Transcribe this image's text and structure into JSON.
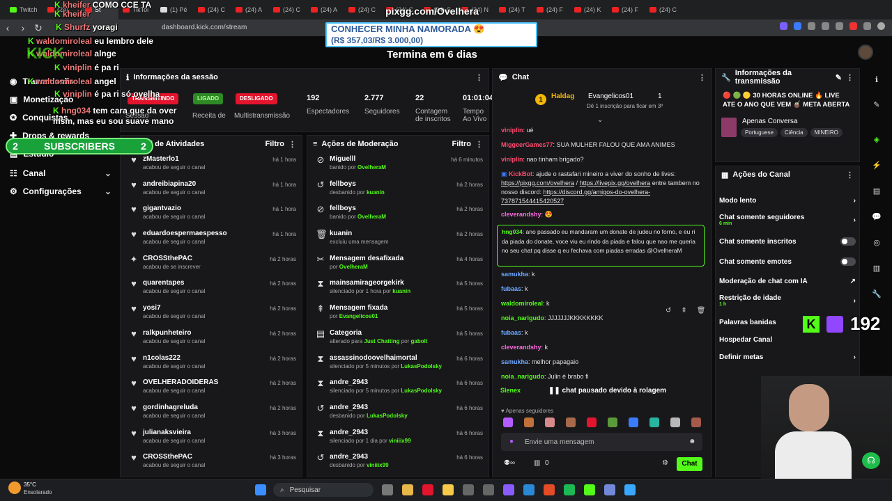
{
  "browser": {
    "tabs": [
      "Twitch",
      "(24)",
      "St",
      "TikToi",
      "(1) Pé",
      "(24) C",
      "(24) A",
      "(24) C",
      "(24) A",
      "(24) C",
      "(24) C",
      "(24) C",
      "(24) N",
      "(24) T",
      "(24) F",
      "(24) K",
      "(24) F",
      "(24) C"
    ],
    "url": "dashboard.kick.com/stream"
  },
  "overlay": {
    "pix": "pixgg.com/Ovelhera",
    "banner_line1": "CONHECER MINHA NAMORADA 😍",
    "banner_line2": "(R$ 357,03/R$ 3.000,00)",
    "termina": "Termina em 6 dias",
    "subs_left": "2",
    "subs_label": "SUBSCRIBERS",
    "subs_right": "2",
    "kick_count": "192",
    "stream_chat": [
      {
        "user": "kheifer",
        "msg": "COMO CCE TA"
      },
      {
        "user": "kheifer",
        "msg": ""
      },
      {
        "user": "Shurfz",
        "msg": "yoragi"
      },
      {
        "user": "waldomiroleal",
        "msg": "eu lembro dele"
      },
      {
        "user": "waldomiroleal",
        "msg": "alnge"
      },
      {
        "user": "viniplin",
        "msg": "é pa ri"
      },
      {
        "user": "waldomiroleal",
        "msg": "angel"
      },
      {
        "user": "viniplin",
        "msg": "é pa ri só ovelha"
      },
      {
        "user": "hng034",
        "msg": "tem cara que da over msm, mas eu sou suave mano"
      }
    ]
  },
  "nav": {
    "items": [
      "Transmissão",
      "Monetização",
      "Conquistas",
      "Drops & rewards",
      "Estúdio",
      "Canal",
      "Configurações"
    ]
  },
  "session": {
    "title": "Informações da sessão",
    "badges": [
      "TRANSMITINDO",
      "LIGADO",
      "DESLIGADO"
    ],
    "labels": [
      "Sessão",
      "Receita de",
      "Multistransmissão"
    ],
    "stats": [
      {
        "value": "192",
        "label": "Espectadores"
      },
      {
        "value": "2.777",
        "label": "Seguidores"
      },
      {
        "value": "22",
        "label": "Contagem de inscritos"
      },
      {
        "value": "01:01:04",
        "label": "Tempo Ao Vivo"
      }
    ]
  },
  "activity": {
    "title": "Feed de Atividades",
    "filter": "Filtro",
    "rows": [
      {
        "name": "zMasterlo1",
        "desc": "acabou de seguir o canal",
        "time": "há 1 hora",
        "icon": "heart"
      },
      {
        "name": "andreibiapina20",
        "desc": "acabou de seguir o canal",
        "time": "há 1 hora",
        "icon": "heart"
      },
      {
        "name": "gigantvazio",
        "desc": "acabou de seguir o canal",
        "time": "há 1 hora",
        "icon": "heart"
      },
      {
        "name": "eduardoespermaespesso",
        "desc": "acabou de seguir o canal",
        "time": "há 1 hora",
        "icon": "heart"
      },
      {
        "name": "CROSSthePAC",
        "desc": "acabou de se inscrever",
        "time": "há 2 horas",
        "icon": "star"
      },
      {
        "name": "quarentapes",
        "desc": "acabou de seguir o canal",
        "time": "há 2 horas",
        "icon": "heart"
      },
      {
        "name": "yosi7",
        "desc": "acabou de seguir o canal",
        "time": "há 2 horas",
        "icon": "heart"
      },
      {
        "name": "ralkpunheteiro",
        "desc": "acabou de seguir o canal",
        "time": "há 2 horas",
        "icon": "heart"
      },
      {
        "name": "n1colas222",
        "desc": "acabou de seguir o canal",
        "time": "há 2 horas",
        "icon": "heart"
      },
      {
        "name": "OVELHERADOIDERAS",
        "desc": "acabou de seguir o canal",
        "time": "há 2 horas",
        "icon": "heart"
      },
      {
        "name": "gordinhagreluda",
        "desc": "acabou de seguir o canal",
        "time": "há 2 horas",
        "icon": "heart"
      },
      {
        "name": "julianaksvieira",
        "desc": "acabou de seguir o canal",
        "time": "há 3 horas",
        "icon": "heart"
      },
      {
        "name": "CROSSthePAC",
        "desc": "acabou de seguir o canal",
        "time": "há 3 horas",
        "icon": "heart"
      }
    ]
  },
  "moderation": {
    "title": "Ações de Moderação",
    "filter": "Filtro",
    "rows": [
      {
        "name": "Miguelll",
        "desc": "banido por",
        "by": "OvelheraM",
        "time": "há 6 minutos",
        "icon": "ban"
      },
      {
        "name": "fellboys",
        "desc": "desbanido por",
        "by": "kuanin",
        "time": "há 2 horas",
        "icon": "undo"
      },
      {
        "name": "fellboys",
        "desc": "banido por",
        "by": "OvelheraM",
        "time": "há 2 horas",
        "icon": "ban"
      },
      {
        "name": "kuanin",
        "desc": "excluiu uma mensagem",
        "by": "",
        "time": "há 2 horas",
        "icon": "trash"
      },
      {
        "name": "Mensagem desafixada",
        "desc": "por",
        "by": "OvelheraM",
        "time": "há 4 horas",
        "icon": "unpin"
      },
      {
        "name": "mainsamirageorgekirk",
        "desc": "silenciado por 1 hora por",
        "by": "kuanin",
        "time": "há 5 horas",
        "icon": "hourglass"
      },
      {
        "name": "Mensagem fixada",
        "desc": "por",
        "by": "Evangelicos01",
        "time": "há 5 horas",
        "icon": "pin"
      },
      {
        "name": "Categoria",
        "desc": "alterado para",
        "by": "Just Chatting",
        "by2": "gabolt",
        "time": "há 5 horas",
        "icon": "doc"
      },
      {
        "name": "assassinodoovelhaimortal",
        "desc": "silenciado por 5 minutos por",
        "by": "LukasPodolsky",
        "time": "há 6 horas",
        "icon": "hourglass"
      },
      {
        "name": "andre_2943",
        "desc": "silenciado por 5 minutos por",
        "by": "LukasPodolsky",
        "time": "há 6 horas",
        "icon": "hourglass"
      },
      {
        "name": "andre_2943",
        "desc": "desbanido por",
        "by": "LukasPodolsky",
        "time": "há 6 horas",
        "icon": "undo"
      },
      {
        "name": "andre_2943",
        "desc": "silenciado por 1 dia por",
        "by": "viniiix99",
        "time": "há 6 horas",
        "icon": "hourglass"
      },
      {
        "name": "andre_2943",
        "desc": "desbanido por",
        "by": "viniiix99",
        "time": "há 6 horas",
        "icon": "undo"
      }
    ]
  },
  "chat": {
    "title": "Chat",
    "pinned_user": "Haldag",
    "pinned_name": "Evangelicos01",
    "pinned_count": "1",
    "pinned_sub": "Dê 1 inscrição para ficar em 3º",
    "messages": [
      {
        "user": "viniplin",
        "color": "#ff4b6e",
        "text": "ué"
      },
      {
        "user": "MiggeerGames77",
        "color": "#ff4b6e",
        "text": "SUA MULHER FALOU QUE AMA ANIMES"
      },
      {
        "user": "viniplin",
        "color": "#ff4b6e",
        "text": "nao tinham brigado?"
      }
    ],
    "kickbot_user": "KickBot",
    "kickbot_text1": "ajude o rastafari mineiro a viver do sonho de lives:",
    "kickbot_link1": "https://pixgg.com/ovelhera",
    "kickbot_sep": "/",
    "kickbot_link2": "https://livepix.gg/ovelhera",
    "kickbot_text2": "entre tambem no nosso discord:",
    "kickbot_link3": "https://discord.gg/amigos-do-ovelhera-737871544415420527",
    "m_clever": {
      "user": "cleverandshy",
      "text": "😍"
    },
    "hl_user": "hng034",
    "hl_text": "ano passado eu mandaram um donate de judeu no forno, e eu ri da piada do donate, voce viu eu rindo da piada e falou que nao me queria no seu chat pq disse q eu fechava com piadas erradas @OvelheraM",
    "messages2": [
      {
        "user": "samukha",
        "color": "#6ea8ff",
        "text": "k"
      },
      {
        "user": "fubaas",
        "color": "#6ea8ff",
        "text": "k"
      },
      {
        "user": "waldomiroleal",
        "color": "#53fc18",
        "text": "k"
      },
      {
        "user": "noia_narigudo",
        "color": "#53fc18",
        "text": "JJJJJJJKKKKKKKK"
      },
      {
        "user": "fubaas",
        "color": "#6ea8ff",
        "text": "k"
      },
      {
        "user": "cleverandshy",
        "color": "#ff6be0",
        "text": "k"
      },
      {
        "user": "samukha",
        "color": "#6ea8ff",
        "text": "melhor papagaio"
      },
      {
        "user": "noia_narigudo",
        "color": "#53fc18",
        "text": "Julin é brabo fi"
      }
    ],
    "paused": "chat pausado devido à rolagem",
    "slenex": "Slenex",
    "followers_only": "Apenas seguidores",
    "placeholder": "Envie uma mensagem",
    "count": "0",
    "send": "Chat"
  },
  "transmission": {
    "title": "Informações da transmissão",
    "stream_title": "🔴 🟢 🟡 30 HORAS ONLINE 🔥 LIVE ATE O ANO QUE VEM 🧉 META ABERTA PR...",
    "category": "Apenas Conversa",
    "tags": [
      "Portuguese",
      "Ciência",
      "MINEIRO"
    ]
  },
  "channel_actions": {
    "title": "Ações do Canal",
    "rows": [
      {
        "label": "Modo lento",
        "sub": "",
        "type": "chev"
      },
      {
        "label": "Chat somente seguidores",
        "sub": "6 min",
        "type": "chev"
      },
      {
        "label": "Chat somente inscritos",
        "sub": "",
        "type": "toggle"
      },
      {
        "label": "Chat somente emotes",
        "sub": "",
        "type": "toggle"
      },
      {
        "label": "Moderação de chat com IA",
        "sub": "",
        "type": "ext"
      },
      {
        "label": "Restrição de idade",
        "sub": "1 h",
        "type": "chev"
      },
      {
        "label": "Palavras banidas",
        "sub": "",
        "type": "none"
      },
      {
        "label": "Hospedar Canal",
        "sub": "",
        "type": "none"
      },
      {
        "label": "Definir metas",
        "sub": "",
        "type": "chev"
      }
    ]
  },
  "taskbar": {
    "temp": "35°C",
    "weather": "Ensolarado",
    "search": "Pesquisar"
  },
  "colors": {
    "accent": "#53fc18",
    "red": "#e3142d"
  }
}
